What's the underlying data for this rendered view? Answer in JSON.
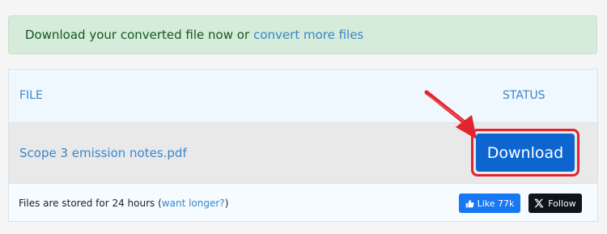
{
  "alert": {
    "message": "Download your converted file now or",
    "link": "convert more files"
  },
  "table": {
    "col_file": "FILE",
    "col_status": "STATUS",
    "row": {
      "filename": "Scope 3 emission notes.pdf",
      "download_label": "Download"
    },
    "footer": {
      "text_before": "Files are stored for 24 hours (",
      "link": "want longer?",
      "text_after": ")",
      "like_label": "Like 77k",
      "follow_label": "Follow"
    }
  },
  "colors": {
    "alert_bg": "#d4ecd9",
    "link": "#3a86c8",
    "download_button": "#0d66d0",
    "highlight_red": "#e2242e",
    "like_button": "#1877f2",
    "follow_button": "#0f1419"
  },
  "icons": [
    "thumbs-up-icon",
    "x-logo-icon",
    "red-arrow-icon"
  ]
}
